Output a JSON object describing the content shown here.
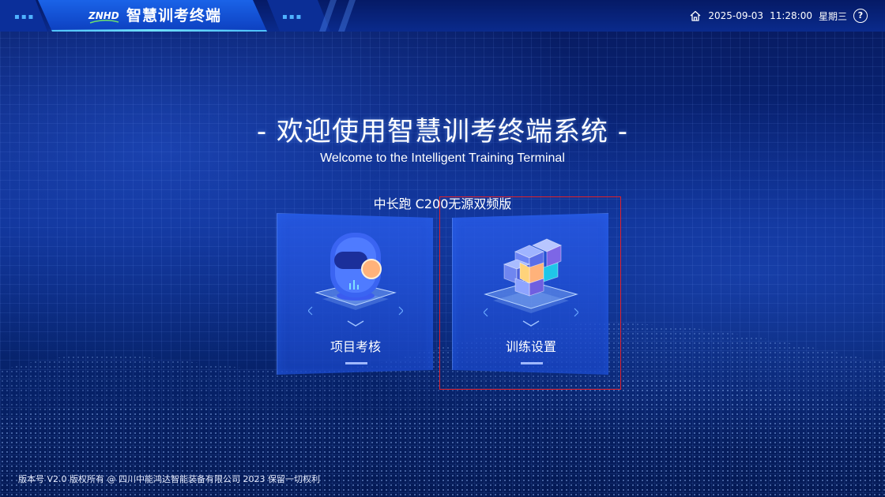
{
  "header": {
    "logo_text": "ZNHD",
    "app_title": "智慧训考终端",
    "date": "2025-09-03",
    "time": "11:28:00",
    "weekday": "星期三",
    "home_icon": "home-icon",
    "help_icon": "help-icon",
    "help_glyph": "?",
    "accent_color": "#1a63e8"
  },
  "hero": {
    "title": "- 欢迎使用智慧训考终端系统 -",
    "subtitle": "Welcome to the Intelligent Training Terminal",
    "device_name": "中长跑 C200无源双频版"
  },
  "cards": [
    {
      "label": "项目考核",
      "icon": "robot-icon"
    },
    {
      "label": "训练设置",
      "icon": "cubes-icon"
    }
  ],
  "footer": {
    "text": "版本号 V2.0 版权所有 @ 四川中能鸿达智能装备有限公司 2023 保留一切权利"
  }
}
